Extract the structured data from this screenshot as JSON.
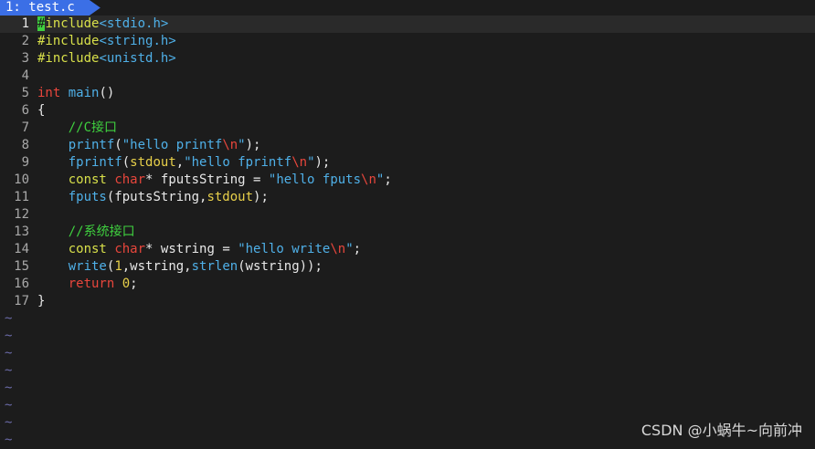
{
  "tab": {
    "label": "1: test.c"
  },
  "lines": [
    {
      "n": "1",
      "tokens": [
        [
          "cursor",
          "#"
        ],
        [
          "pp",
          "include"
        ],
        [
          "hdr",
          "<stdio.h>"
        ]
      ]
    },
    {
      "n": "2",
      "tokens": [
        [
          "pp",
          "#include"
        ],
        [
          "hdr",
          "<string.h>"
        ]
      ]
    },
    {
      "n": "3",
      "tokens": [
        [
          "pp",
          "#include"
        ],
        [
          "hdr",
          "<unistd.h>"
        ]
      ]
    },
    {
      "n": "4",
      "tokens": []
    },
    {
      "n": "5",
      "tokens": [
        [
          "kw",
          "int"
        ],
        [
          "plain",
          " "
        ],
        [
          "fn",
          "main"
        ],
        [
          "plain",
          "()"
        ]
      ]
    },
    {
      "n": "6",
      "tokens": [
        [
          "plain",
          "{"
        ]
      ]
    },
    {
      "n": "7",
      "tokens": [
        [
          "plain",
          "    "
        ],
        [
          "cm",
          "//C接口"
        ]
      ]
    },
    {
      "n": "8",
      "tokens": [
        [
          "plain",
          "    "
        ],
        [
          "fn",
          "printf"
        ],
        [
          "plain",
          "("
        ],
        [
          "str",
          "\"hello printf"
        ],
        [
          "esc",
          "\\n"
        ],
        [
          "str",
          "\""
        ],
        [
          "plain",
          ");"
        ]
      ]
    },
    {
      "n": "9",
      "tokens": [
        [
          "plain",
          "    "
        ],
        [
          "fn",
          "fprintf"
        ],
        [
          "plain",
          "("
        ],
        [
          "id",
          "stdout"
        ],
        [
          "plain",
          ","
        ],
        [
          "str",
          "\"hello fprintf"
        ],
        [
          "esc",
          "\\n"
        ],
        [
          "str",
          "\""
        ],
        [
          "plain",
          ");"
        ]
      ]
    },
    {
      "n": "10",
      "tokens": [
        [
          "plain",
          "    "
        ],
        [
          "pp",
          "const"
        ],
        [
          "plain",
          " "
        ],
        [
          "kw",
          "char"
        ],
        [
          "plain",
          "* fputsString = "
        ],
        [
          "str",
          "\"hello fputs"
        ],
        [
          "esc",
          "\\n"
        ],
        [
          "str",
          "\""
        ],
        [
          "plain",
          ";"
        ]
      ]
    },
    {
      "n": "11",
      "tokens": [
        [
          "plain",
          "    "
        ],
        [
          "fn",
          "fputs"
        ],
        [
          "plain",
          "(fputsString,"
        ],
        [
          "id",
          "stdout"
        ],
        [
          "plain",
          ");"
        ]
      ]
    },
    {
      "n": "12",
      "tokens": []
    },
    {
      "n": "13",
      "tokens": [
        [
          "plain",
          "    "
        ],
        [
          "cm",
          "//系统接口"
        ]
      ]
    },
    {
      "n": "14",
      "tokens": [
        [
          "plain",
          "    "
        ],
        [
          "pp",
          "const"
        ],
        [
          "plain",
          " "
        ],
        [
          "kw",
          "char"
        ],
        [
          "plain",
          "* wstring = "
        ],
        [
          "str",
          "\"hello write"
        ],
        [
          "esc",
          "\\n"
        ],
        [
          "str",
          "\""
        ],
        [
          "plain",
          ";"
        ]
      ]
    },
    {
      "n": "15",
      "tokens": [
        [
          "plain",
          "    "
        ],
        [
          "fn",
          "write"
        ],
        [
          "plain",
          "("
        ],
        [
          "num",
          "1"
        ],
        [
          "plain",
          ",wstring,"
        ],
        [
          "fn",
          "strlen"
        ],
        [
          "plain",
          "(wstring));"
        ]
      ]
    },
    {
      "n": "16",
      "tokens": [
        [
          "plain",
          "    "
        ],
        [
          "kw",
          "return"
        ],
        [
          "plain",
          " "
        ],
        [
          "num",
          "0"
        ],
        [
          "plain",
          ";"
        ]
      ]
    },
    {
      "n": "17",
      "tokens": [
        [
          "plain",
          "}"
        ]
      ]
    }
  ],
  "tilde": "~",
  "empty_line_count": 8,
  "watermark": "CSDN @小蜗牛~向前冲"
}
